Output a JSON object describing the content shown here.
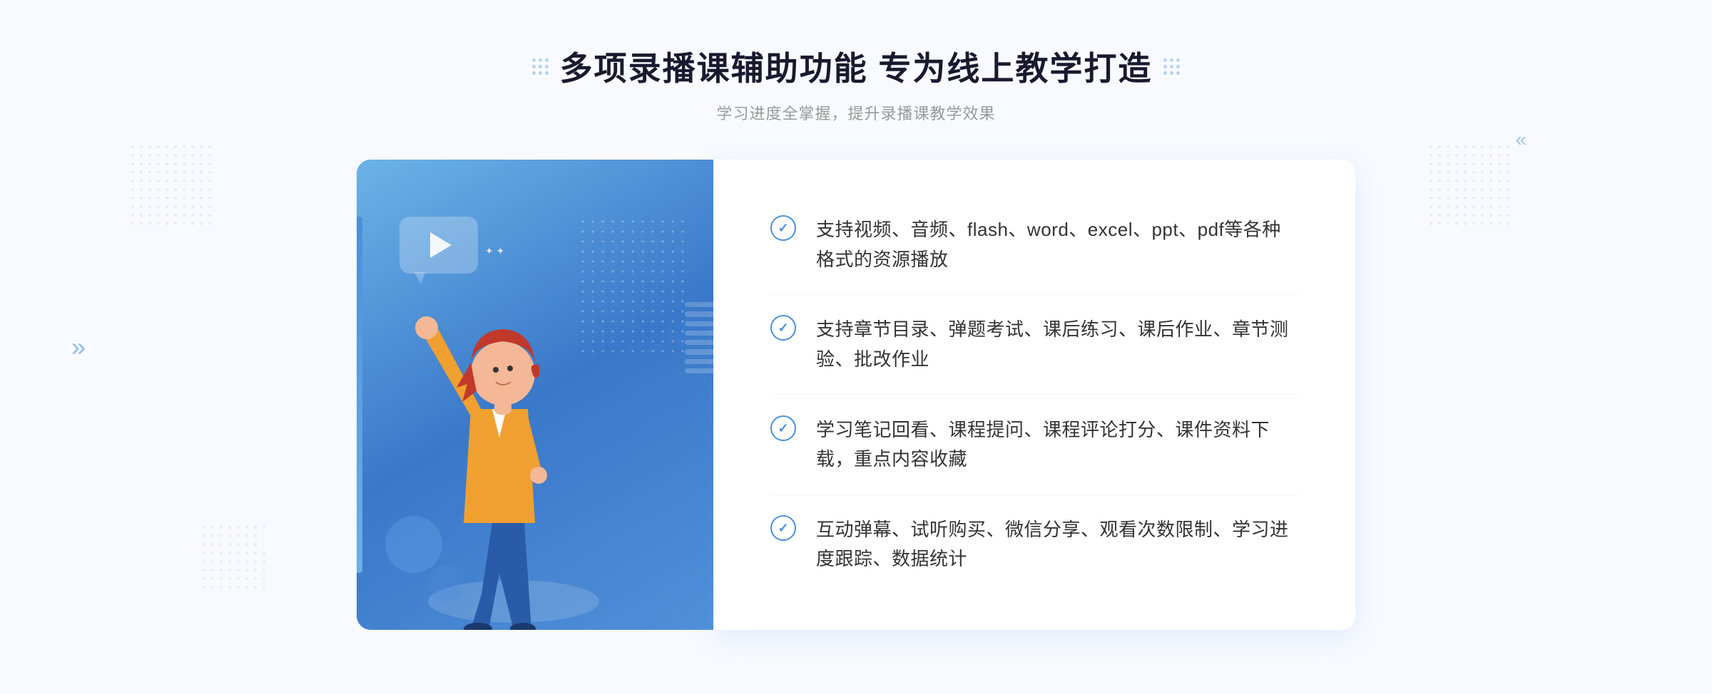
{
  "header": {
    "title": "多项录播课辅助功能 专为线上教学打造",
    "subtitle": "学习进度全掌握，提升录播课教学效果",
    "title_dots_aria": "decorative dots"
  },
  "features": [
    {
      "id": 1,
      "text": "支持视频、音频、flash、word、excel、ppt、pdf等各种格式的资源播放"
    },
    {
      "id": 2,
      "text": "支持章节目录、弹题考试、课后练习、课后作业、章节测验、批改作业"
    },
    {
      "id": 3,
      "text": "学习笔记回看、课程提问、课程评论打分、课件资料下载，重点内容收藏"
    },
    {
      "id": 4,
      "text": "互动弹幕、试听购买、微信分享、观看次数限制、学习进度跟踪、数据统计"
    }
  ],
  "decorations": {
    "arrow_left": "»",
    "arrow_right": "«",
    "check_symbol": "✓"
  },
  "colors": {
    "primary_blue": "#4a90d9",
    "light_blue": "#6bb3e8",
    "dark_blue": "#3a78c9",
    "text_dark": "#1a1a2e",
    "text_medium": "#333333",
    "text_light": "#999999",
    "bg_light": "#f8faff",
    "white": "#ffffff"
  }
}
